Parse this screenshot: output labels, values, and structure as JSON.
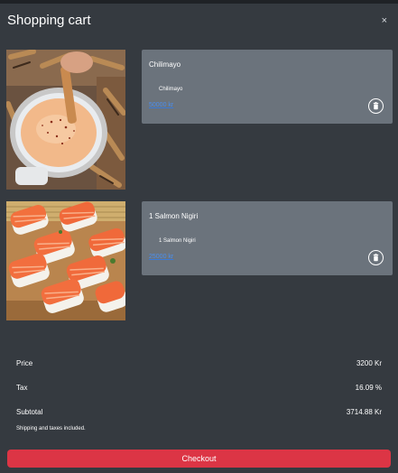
{
  "header": {
    "title": "Shopping cart",
    "close_label": "×"
  },
  "cart": {
    "items": [
      {
        "name": "Chilimayo",
        "variant": "Chilimayo",
        "price": "50000 kr",
        "image": "chili-mayo-dip-with-fries-photo"
      },
      {
        "name": "1 Salmon Nigiri",
        "variant": "1 Salmon Nigiri",
        "price": "25000 kr",
        "image": "salmon-nigiri-sushi-photo"
      }
    ]
  },
  "summary": {
    "price_label": "Price",
    "price_value": "3200 Kr",
    "tax_label": "Tax",
    "tax_value": "16.09 %",
    "subtotal_label": "Subtotal",
    "subtotal_value": "3714.88 Kr",
    "note": "Shipping and taxes included."
  },
  "checkout": {
    "label": "Checkout"
  },
  "colors": {
    "background": "#353a40",
    "card": "#6b737c",
    "price_link": "#4a8ff0",
    "checkout": "#dc3545"
  },
  "icons": {
    "close": "close-icon",
    "remove": "trash-icon"
  }
}
